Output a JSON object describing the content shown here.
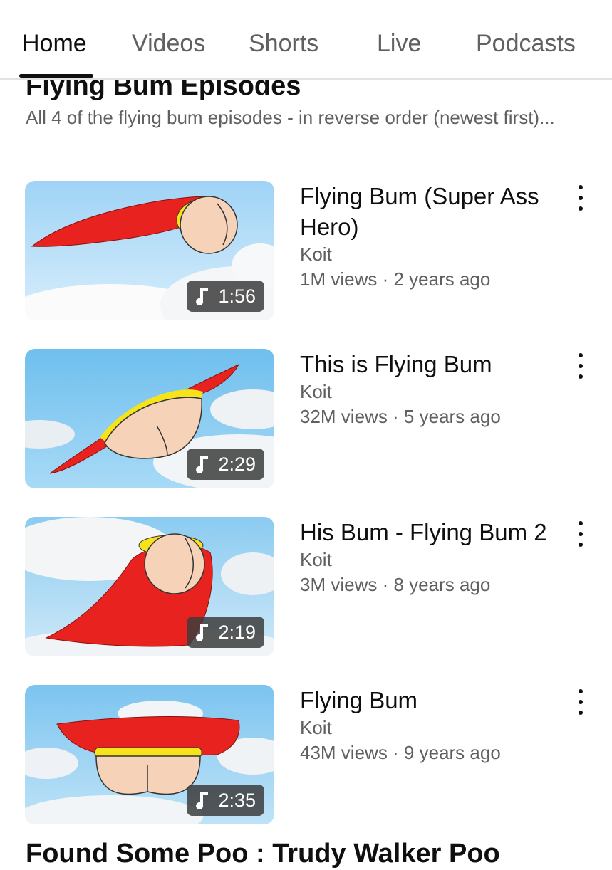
{
  "tabs": [
    {
      "label": "Home"
    },
    {
      "label": "Videos"
    },
    {
      "label": "Shorts"
    },
    {
      "label": "Live"
    },
    {
      "label": "Podcasts"
    }
  ],
  "active_tab": "Home",
  "playlist": {
    "title": "Flying Bum Episodes",
    "description": "All 4 of the flying bum episodes - in reverse order (newest first)..."
  },
  "videos": [
    {
      "title": "Flying Bum (Super Ass Hero)",
      "channel": "Koit",
      "stats": "1M views · 2 years ago",
      "duration": "1:56"
    },
    {
      "title": "This is Flying Bum",
      "channel": "Koit",
      "stats": "32M views · 5 years ago",
      "duration": "2:29"
    },
    {
      "title": "His Bum - Flying Bum 2",
      "channel": "Koit",
      "stats": "3M views · 8 years ago",
      "duration": "2:19"
    },
    {
      "title": "Flying Bum",
      "channel": "Koit",
      "stats": "43M views · 9 years ago",
      "duration": "2:35"
    }
  ],
  "next_section": {
    "title": "Found Some Poo : Trudy Walker Poo"
  },
  "icons": {
    "duration_badge": "music-note-icon",
    "overflow": "more-vert-icon"
  },
  "colors": {
    "cape": "#e8231f",
    "belt": "#f6e31a",
    "skin": "#f5d2b8",
    "sky": "#86c8f2"
  }
}
